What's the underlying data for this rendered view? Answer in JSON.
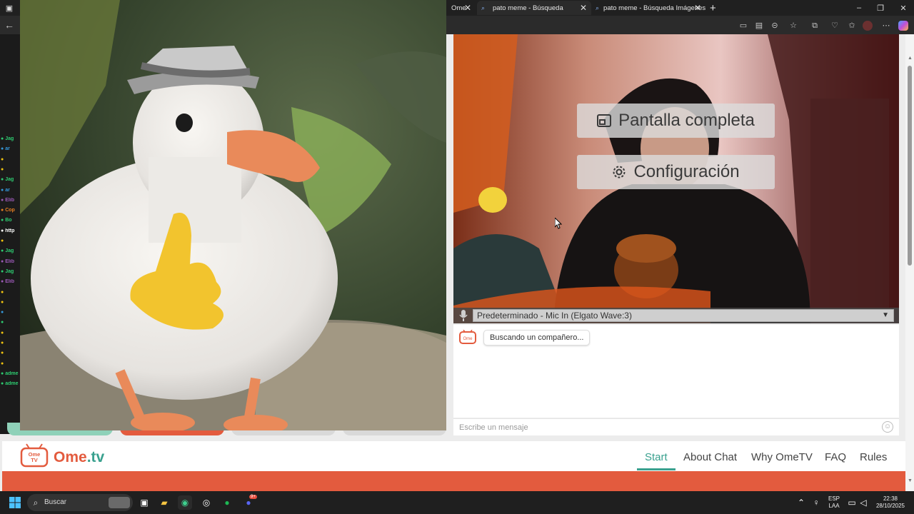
{
  "browser": {
    "tabs": [
      {
        "label": "Ome",
        "icon": "ome-tab-icon"
      },
      {
        "label": "pato meme - Búsqueda",
        "icon": "search-tab-icon"
      },
      {
        "label": "pato meme - Búsqueda Imágenes",
        "icon": "search-tab-icon"
      }
    ],
    "new_tab_label": "+",
    "colors": {
      "tabbar": "#202020",
      "addressbar": "#2b2b2b"
    }
  },
  "stream_chat": {
    "names": [
      "Jag",
      "ar",
      "",
      "",
      "Jag",
      "ar",
      "Elib",
      "Cop",
      "Bo",
      "http",
      "",
      "Jag",
      "Elib",
      "Jag",
      "Elib",
      "",
      "",
      "",
      "",
      "",
      "",
      "",
      "",
      "adme",
      "adme"
    ],
    "colors": [
      "#2ecc71",
      "#3498db",
      "#f1c40f",
      "#f1c40f",
      "#2ecc71",
      "#3498db",
      "#9b59b6",
      "#e67e22",
      "#2ecc71",
      "#ffffff",
      "#f1c40f",
      "#2ecc71",
      "#9b59b6",
      "#2ecc71",
      "#9b59b6",
      "#f1c40f",
      "#f1c40f",
      "#3498db",
      "#2ecc71",
      "#f1c40f",
      "#f1c40f",
      "#f1c40f",
      "#f1c40f",
      "#2ecc71",
      "#2ecc71"
    ]
  },
  "camera": {
    "fullscreen_label": "Pantalla completa",
    "settings_label": "Configuración",
    "mic_device": "Predeterminado - Mic In (Elgato Wave:3)"
  },
  "chat": {
    "status_message": "Buscando un compañero...",
    "input_placeholder": "Escribe un mensaje"
  },
  "site_nav": {
    "logo_badge": "Ome TV",
    "logo_word": "Ome",
    "logo_suffix": ".tv",
    "links": [
      "Start",
      "About Chat",
      "Why OmeTV",
      "FAQ",
      "Rules"
    ],
    "active": "Start",
    "colors": {
      "brand_orange": "#e35b3e",
      "brand_teal": "#3aa18f"
    }
  },
  "taskbar": {
    "search_label": "Buscar",
    "language": "ESP",
    "layout": "LAA",
    "time": "22:38",
    "date": "28/10/2025",
    "discord_badge": "9+"
  }
}
